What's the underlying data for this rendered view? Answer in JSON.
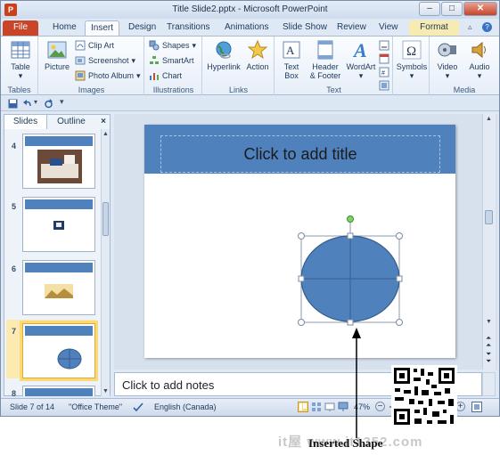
{
  "window": {
    "title": "Title Slide2.pptx - Microsoft PowerPoint",
    "app_icon": "P",
    "controls": [
      "–",
      "□",
      "✕"
    ]
  },
  "ribbon_tabs": [
    "File",
    "Home",
    "Insert",
    "Design",
    "Transitions",
    "Animations",
    "Slide Show",
    "Review",
    "View",
    "Format"
  ],
  "active_tab": "Insert",
  "contextual_tab": "Format",
  "ribbon": {
    "groups": [
      {
        "name": "Tables",
        "buttons": [
          "Table"
        ]
      },
      {
        "name": "Images",
        "buttons": [
          "Picture",
          "Clip Art",
          "Screenshot",
          "Photo Album"
        ]
      },
      {
        "name": "Illustrations",
        "buttons": [
          "Shapes",
          "SmartArt",
          "Chart"
        ]
      },
      {
        "name": "Links",
        "buttons": [
          "Hyperlink",
          "Action"
        ]
      },
      {
        "name": "Text",
        "buttons": [
          "Text Box",
          "Header & Footer",
          "WordArt"
        ]
      },
      {
        "name": "",
        "buttons": [
          "Symbols"
        ]
      },
      {
        "name": "Media",
        "buttons": [
          "Video",
          "Audio"
        ]
      }
    ],
    "labels": {
      "table": "Table",
      "picture": "Picture",
      "clip_art": "Clip Art",
      "screenshot": "Screenshot",
      "photo_album": "Photo Album",
      "shapes": "Shapes",
      "smartart": "SmartArt",
      "chart": "Chart",
      "hyperlink": "Hyperlink",
      "action": "Action",
      "text_box_1": "Text",
      "text_box_2": "Box",
      "header_footer_1": "Header",
      "header_footer_2": "& Footer",
      "wordart": "WordArt",
      "symbols": "Symbols",
      "video": "Video",
      "audio": "Audio",
      "group_tables": "Tables",
      "group_images": "Images",
      "group_illustrations": "Illustrations",
      "group_links": "Links",
      "group_text": "Text",
      "group_media": "Media"
    }
  },
  "slides_pane": {
    "tabs": [
      "Slides",
      "Outline"
    ],
    "close": "×",
    "slide_numbers": [
      "4",
      "5",
      "6",
      "7",
      "8"
    ],
    "selected": "7"
  },
  "slide": {
    "title_placeholder": "Click to add title"
  },
  "notes": {
    "placeholder": "Click to add notes"
  },
  "status": {
    "slide": "Slide 7 of 14",
    "theme": "\"Office Theme\"",
    "language": "English (Canada)",
    "zoom": "47%"
  },
  "annotation": {
    "label": "Inserted Shape",
    "watermark": "it屋 www.it1352.com"
  },
  "colors": {
    "accent": "#4f81bd",
    "file_tab": "#c8452a",
    "selection": "#f9d97a"
  }
}
